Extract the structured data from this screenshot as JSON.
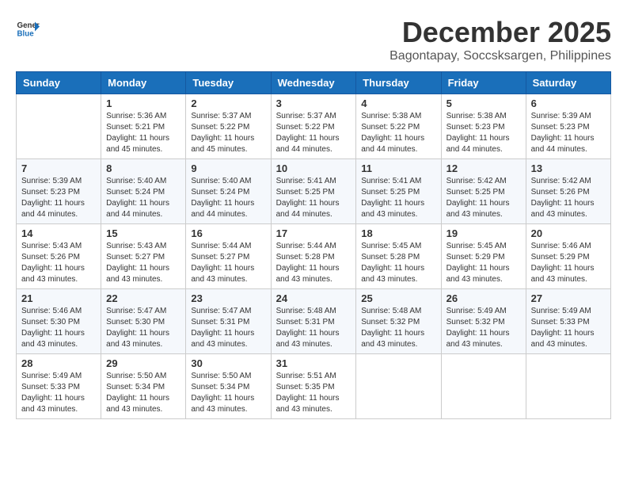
{
  "header": {
    "logo_general": "General",
    "logo_blue": "Blue",
    "month": "December 2025",
    "location": "Bagontapay, Soccsksargen, Philippines"
  },
  "weekdays": [
    "Sunday",
    "Monday",
    "Tuesday",
    "Wednesday",
    "Thursday",
    "Friday",
    "Saturday"
  ],
  "weeks": [
    [
      {
        "day": "",
        "sunrise": "",
        "sunset": "",
        "daylight": ""
      },
      {
        "day": "1",
        "sunrise": "Sunrise: 5:36 AM",
        "sunset": "Sunset: 5:21 PM",
        "daylight": "Daylight: 11 hours and 45 minutes."
      },
      {
        "day": "2",
        "sunrise": "Sunrise: 5:37 AM",
        "sunset": "Sunset: 5:22 PM",
        "daylight": "Daylight: 11 hours and 45 minutes."
      },
      {
        "day": "3",
        "sunrise": "Sunrise: 5:37 AM",
        "sunset": "Sunset: 5:22 PM",
        "daylight": "Daylight: 11 hours and 44 minutes."
      },
      {
        "day": "4",
        "sunrise": "Sunrise: 5:38 AM",
        "sunset": "Sunset: 5:22 PM",
        "daylight": "Daylight: 11 hours and 44 minutes."
      },
      {
        "day": "5",
        "sunrise": "Sunrise: 5:38 AM",
        "sunset": "Sunset: 5:23 PM",
        "daylight": "Daylight: 11 hours and 44 minutes."
      },
      {
        "day": "6",
        "sunrise": "Sunrise: 5:39 AM",
        "sunset": "Sunset: 5:23 PM",
        "daylight": "Daylight: 11 hours and 44 minutes."
      }
    ],
    [
      {
        "day": "7",
        "sunrise": "Sunrise: 5:39 AM",
        "sunset": "Sunset: 5:23 PM",
        "daylight": "Daylight: 11 hours and 44 minutes."
      },
      {
        "day": "8",
        "sunrise": "Sunrise: 5:40 AM",
        "sunset": "Sunset: 5:24 PM",
        "daylight": "Daylight: 11 hours and 44 minutes."
      },
      {
        "day": "9",
        "sunrise": "Sunrise: 5:40 AM",
        "sunset": "Sunset: 5:24 PM",
        "daylight": "Daylight: 11 hours and 44 minutes."
      },
      {
        "day": "10",
        "sunrise": "Sunrise: 5:41 AM",
        "sunset": "Sunset: 5:25 PM",
        "daylight": "Daylight: 11 hours and 44 minutes."
      },
      {
        "day": "11",
        "sunrise": "Sunrise: 5:41 AM",
        "sunset": "Sunset: 5:25 PM",
        "daylight": "Daylight: 11 hours and 43 minutes."
      },
      {
        "day": "12",
        "sunrise": "Sunrise: 5:42 AM",
        "sunset": "Sunset: 5:25 PM",
        "daylight": "Daylight: 11 hours and 43 minutes."
      },
      {
        "day": "13",
        "sunrise": "Sunrise: 5:42 AM",
        "sunset": "Sunset: 5:26 PM",
        "daylight": "Daylight: 11 hours and 43 minutes."
      }
    ],
    [
      {
        "day": "14",
        "sunrise": "Sunrise: 5:43 AM",
        "sunset": "Sunset: 5:26 PM",
        "daylight": "Daylight: 11 hours and 43 minutes."
      },
      {
        "day": "15",
        "sunrise": "Sunrise: 5:43 AM",
        "sunset": "Sunset: 5:27 PM",
        "daylight": "Daylight: 11 hours and 43 minutes."
      },
      {
        "day": "16",
        "sunrise": "Sunrise: 5:44 AM",
        "sunset": "Sunset: 5:27 PM",
        "daylight": "Daylight: 11 hours and 43 minutes."
      },
      {
        "day": "17",
        "sunrise": "Sunrise: 5:44 AM",
        "sunset": "Sunset: 5:28 PM",
        "daylight": "Daylight: 11 hours and 43 minutes."
      },
      {
        "day": "18",
        "sunrise": "Sunrise: 5:45 AM",
        "sunset": "Sunset: 5:28 PM",
        "daylight": "Daylight: 11 hours and 43 minutes."
      },
      {
        "day": "19",
        "sunrise": "Sunrise: 5:45 AM",
        "sunset": "Sunset: 5:29 PM",
        "daylight": "Daylight: 11 hours and 43 minutes."
      },
      {
        "day": "20",
        "sunrise": "Sunrise: 5:46 AM",
        "sunset": "Sunset: 5:29 PM",
        "daylight": "Daylight: 11 hours and 43 minutes."
      }
    ],
    [
      {
        "day": "21",
        "sunrise": "Sunrise: 5:46 AM",
        "sunset": "Sunset: 5:30 PM",
        "daylight": "Daylight: 11 hours and 43 minutes."
      },
      {
        "day": "22",
        "sunrise": "Sunrise: 5:47 AM",
        "sunset": "Sunset: 5:30 PM",
        "daylight": "Daylight: 11 hours and 43 minutes."
      },
      {
        "day": "23",
        "sunrise": "Sunrise: 5:47 AM",
        "sunset": "Sunset: 5:31 PM",
        "daylight": "Daylight: 11 hours and 43 minutes."
      },
      {
        "day": "24",
        "sunrise": "Sunrise: 5:48 AM",
        "sunset": "Sunset: 5:31 PM",
        "daylight": "Daylight: 11 hours and 43 minutes."
      },
      {
        "day": "25",
        "sunrise": "Sunrise: 5:48 AM",
        "sunset": "Sunset: 5:32 PM",
        "daylight": "Daylight: 11 hours and 43 minutes."
      },
      {
        "day": "26",
        "sunrise": "Sunrise: 5:49 AM",
        "sunset": "Sunset: 5:32 PM",
        "daylight": "Daylight: 11 hours and 43 minutes."
      },
      {
        "day": "27",
        "sunrise": "Sunrise: 5:49 AM",
        "sunset": "Sunset: 5:33 PM",
        "daylight": "Daylight: 11 hours and 43 minutes."
      }
    ],
    [
      {
        "day": "28",
        "sunrise": "Sunrise: 5:49 AM",
        "sunset": "Sunset: 5:33 PM",
        "daylight": "Daylight: 11 hours and 43 minutes."
      },
      {
        "day": "29",
        "sunrise": "Sunrise: 5:50 AM",
        "sunset": "Sunset: 5:34 PM",
        "daylight": "Daylight: 11 hours and 43 minutes."
      },
      {
        "day": "30",
        "sunrise": "Sunrise: 5:50 AM",
        "sunset": "Sunset: 5:34 PM",
        "daylight": "Daylight: 11 hours and 43 minutes."
      },
      {
        "day": "31",
        "sunrise": "Sunrise: 5:51 AM",
        "sunset": "Sunset: 5:35 PM",
        "daylight": "Daylight: 11 hours and 43 minutes."
      },
      {
        "day": "",
        "sunrise": "",
        "sunset": "",
        "daylight": ""
      },
      {
        "day": "",
        "sunrise": "",
        "sunset": "",
        "daylight": ""
      },
      {
        "day": "",
        "sunrise": "",
        "sunset": "",
        "daylight": ""
      }
    ]
  ]
}
